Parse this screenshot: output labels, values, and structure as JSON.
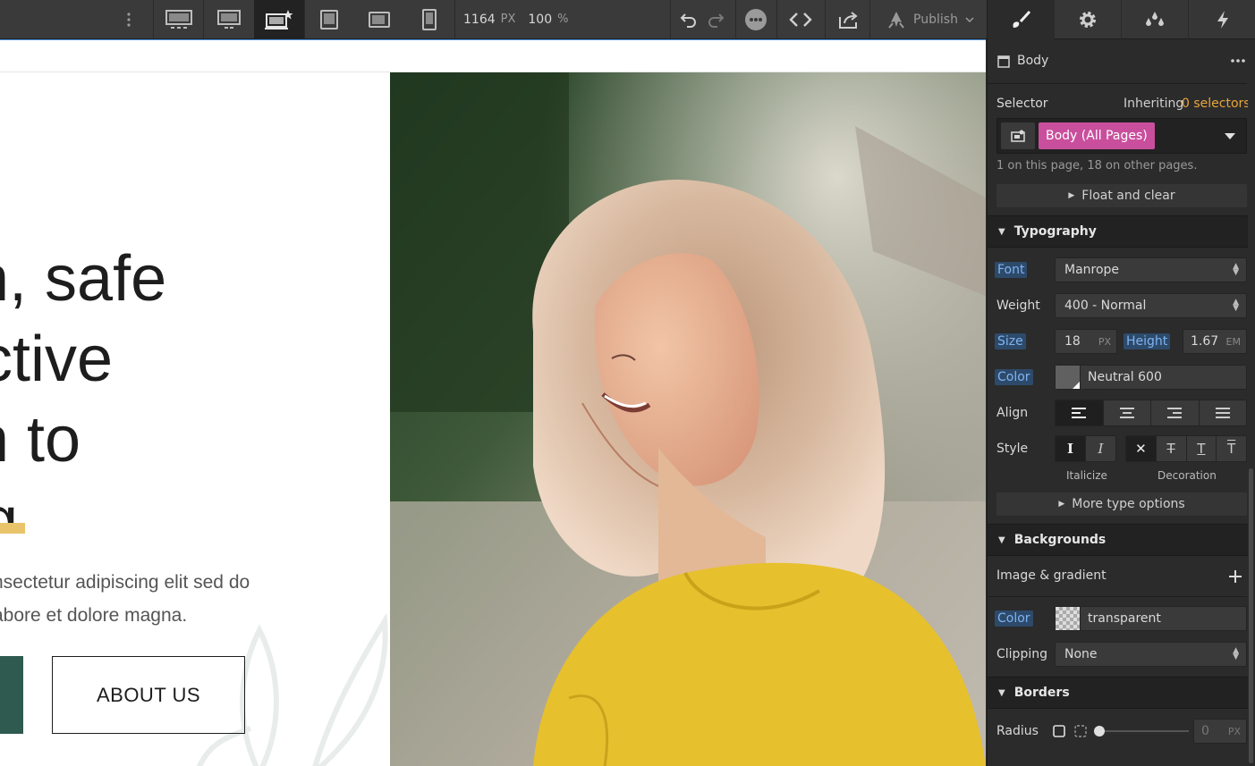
{
  "topbar": {
    "width_value": "1164",
    "width_unit": "PX",
    "zoom_value": "100",
    "zoom_unit": "%",
    "publish_label": "Publish"
  },
  "canvas": {
    "heading_lines": [
      "n, safe",
      "ctive",
      "n to",
      "g"
    ],
    "para_lines": [
      "nsectetur adipiscing elit sed do",
      "abore et dolore magna."
    ],
    "about_button": "ABOUT US"
  },
  "panel": {
    "element_name": "Body",
    "selector_label": "Selector",
    "inheriting_label": "Inheriting",
    "inheriting_count": "0 selectors",
    "selector_tag": "Body (All Pages)",
    "selector_note": "1 on this page, 18 on other pages.",
    "float_clear": "Float and clear",
    "typography": {
      "title": "Typography",
      "font_label": "Font",
      "font_value": "Manrope",
      "weight_label": "Weight",
      "weight_value": "400 - Normal",
      "size_label": "Size",
      "size_value": "18",
      "size_unit": "PX",
      "height_label": "Height",
      "height_value": "1.67",
      "height_unit": "EM",
      "color_label": "Color",
      "color_value": "Neutral 600",
      "align_label": "Align",
      "style_label": "Style",
      "italicize_label": "Italicize",
      "decoration_label": "Decoration",
      "more_type": "More type options"
    },
    "backgrounds": {
      "title": "Backgrounds",
      "image_gradient": "Image & gradient",
      "color_label": "Color",
      "color_value": "transparent",
      "clipping_label": "Clipping",
      "clipping_value": "None"
    },
    "borders": {
      "title": "Borders",
      "radius_label": "Radius",
      "radius_value": "0",
      "radius_unit": "PX"
    }
  },
  "colors": {
    "accent_pink": "#c94f9d",
    "accent_orange": "#e8a53c",
    "highlight_yellow": "#e9c46a",
    "green_button": "#2e5a50",
    "label_blue": "#7fb3f0"
  }
}
